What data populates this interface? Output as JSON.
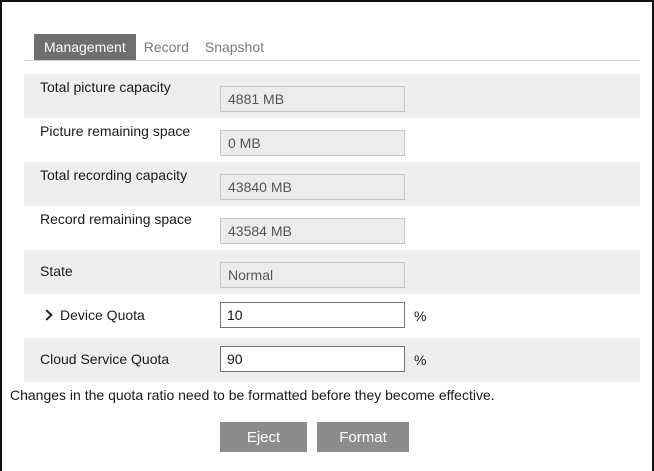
{
  "tabs": [
    {
      "label": "Management",
      "active": true
    },
    {
      "label": "Record",
      "active": false
    },
    {
      "label": "Snapshot",
      "active": false
    }
  ],
  "fields": {
    "total_picture_capacity": {
      "label": "Total picture capacity",
      "value": "4881 MB"
    },
    "picture_remaining_space": {
      "label": "Picture remaining space",
      "value": "0 MB"
    },
    "total_recording_capacity": {
      "label": "Total recording capacity",
      "value": "43840 MB"
    },
    "record_remaining_space": {
      "label": "Record remaining space",
      "value": "43584 MB"
    },
    "state": {
      "label": "State",
      "value": "Normal"
    }
  },
  "quota": {
    "device": {
      "label": "Device Quota",
      "value": "10",
      "unit": "%"
    },
    "cloud": {
      "label": "Cloud Service Quota",
      "value": "90",
      "unit": "%"
    }
  },
  "note": "Changes in the quota ratio need to be formatted before they become effective.",
  "buttons": {
    "eject": "Eject",
    "format": "Format"
  },
  "colors": {
    "active_tab": "#6f6f6f",
    "button": "#8c8c8c",
    "row_shade": "#eeeeee"
  }
}
